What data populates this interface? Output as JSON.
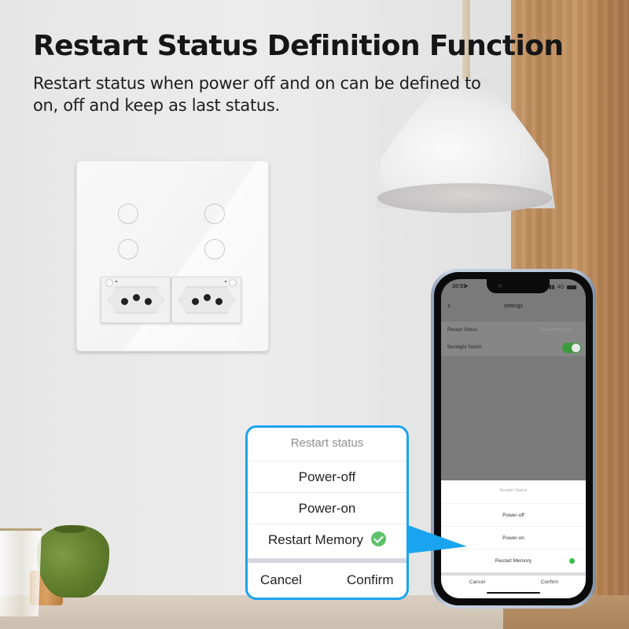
{
  "header": {
    "title": "Restart Status Definition Function",
    "subtitle": "Restart status when power off and on can be defined to on, off and keep as last status."
  },
  "colors": {
    "callout_border": "#1aa4ef",
    "toggle_on": "#3a9b3f",
    "check_green": "#5ec26a"
  },
  "switch_panel": {
    "touch_buttons": 4,
    "outlets": 2
  },
  "phone": {
    "status_bar": {
      "time": "10:01",
      "network": "4G"
    },
    "nav": {
      "back_icon": "chevron-left-icon",
      "title": "settings"
    },
    "settings": [
      {
        "label": "Restart Status",
        "value": "Restart Memory",
        "icon": "chevron-right-icon"
      },
      {
        "label": "Backlight Switch",
        "toggle_on": true
      }
    ],
    "sheet": {
      "title": "Restart Status",
      "options": [
        {
          "label": "Power-off",
          "selected": false
        },
        {
          "label": "Power-on",
          "selected": false
        },
        {
          "label": "Restart Memory",
          "selected": true
        }
      ],
      "cancel": "Cancel",
      "confirm": "Confirm"
    }
  },
  "callout": {
    "title": "Restart status",
    "options": [
      {
        "label": "Power-off",
        "selected": false
      },
      {
        "label": "Power-on",
        "selected": false
      },
      {
        "label": "Restart Memory",
        "selected": true
      }
    ],
    "cancel": "Cancel",
    "confirm": "Confirm"
  }
}
